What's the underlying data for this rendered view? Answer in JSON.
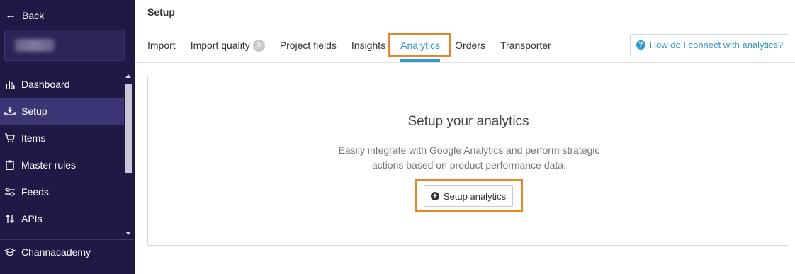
{
  "sidebar": {
    "back_label": "Back",
    "items": [
      {
        "label": "Dashboard",
        "icon": "bar-chart-icon"
      },
      {
        "label": "Setup",
        "icon": "download-tray-icon",
        "active": true
      },
      {
        "label": "Items",
        "icon": "cart-icon"
      },
      {
        "label": "Master rules",
        "icon": "clipboard-icon"
      },
      {
        "label": "Feeds",
        "icon": "sliders-icon"
      },
      {
        "label": "APIs",
        "icon": "swap-vertical-icon"
      }
    ],
    "academy_label": "Channacademy",
    "academy_icon": "graduation-cap-icon"
  },
  "header": {
    "title": "Setup",
    "tabs": [
      {
        "label": "Import"
      },
      {
        "label": "Import quality",
        "badge": "0"
      },
      {
        "label": "Project fields"
      },
      {
        "label": "Insights"
      },
      {
        "label": "Analytics",
        "active": true
      },
      {
        "label": "Orders"
      },
      {
        "label": "Transporter"
      }
    ],
    "help_button_label": "How do I connect with analytics?"
  },
  "card": {
    "title": "Setup your analytics",
    "description_line1": "Easily integrate with Google Analytics and perform strategic",
    "description_line2": "actions based on product performance data.",
    "button_label": "Setup analytics"
  },
  "colors": {
    "sidebar_bg": "#1f1a45",
    "sidebar_active": "#3b3574",
    "accent": "#3397c9",
    "highlight": "#e6862b"
  }
}
